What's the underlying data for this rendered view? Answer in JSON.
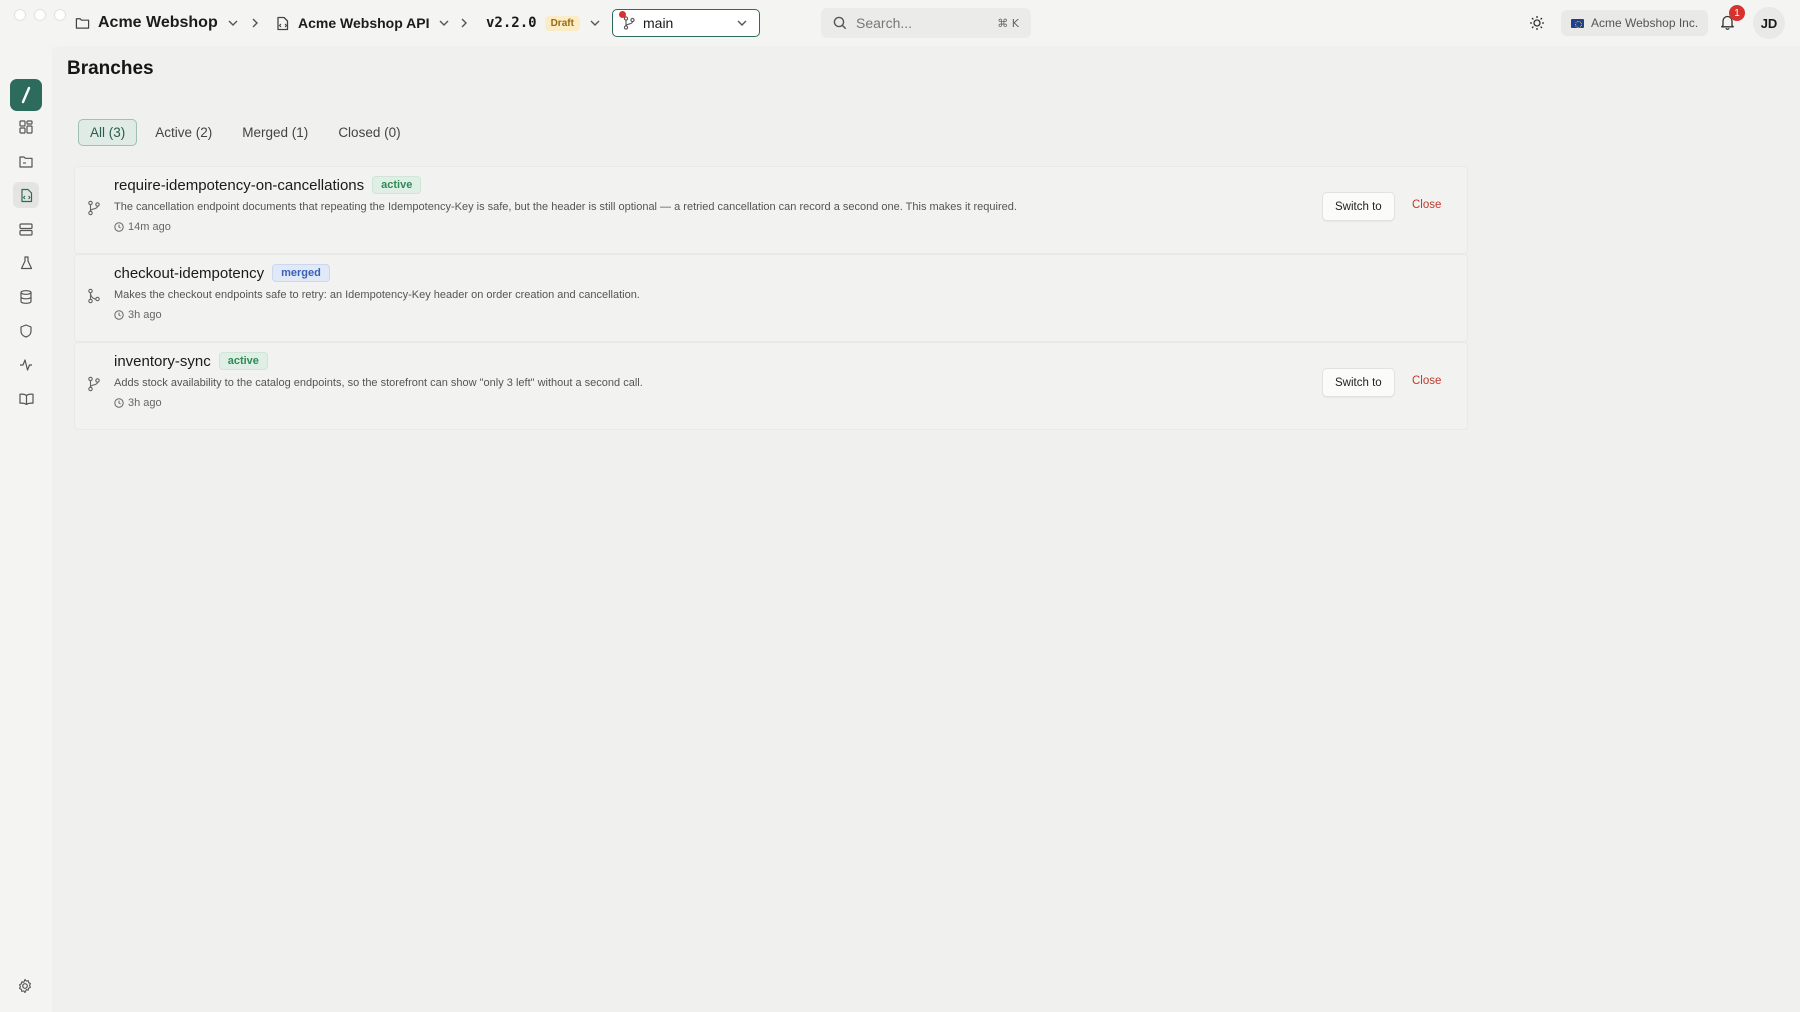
{
  "topbar": {
    "workspace": "Acme Webshop",
    "api": "Acme Webshop API",
    "version": "v2.2.0",
    "version_status": "Draft",
    "branch": "main",
    "search_placeholder": "Search...",
    "search_shortcut": "⌘ K",
    "org_name": "Acme Webshop Inc.",
    "notification_count": "1",
    "avatar_initials": "JD"
  },
  "page": {
    "title": "Branches"
  },
  "tabs": [
    {
      "label": "All (3)",
      "active": true
    },
    {
      "label": "Active (2)",
      "active": false
    },
    {
      "label": "Merged (1)",
      "active": false
    },
    {
      "label": "Closed (0)",
      "active": false
    }
  ],
  "branches": [
    {
      "name": "require-idempotency-on-cancellations",
      "status": "active",
      "description": "The cancellation endpoint documents that repeating the Idempotency-Key is safe, but the header is still optional — a retried cancellation can record a second one. This makes it required.",
      "time": "14m ago",
      "switch_label": "Switch to",
      "close_label": "Close"
    },
    {
      "name": "checkout-idempotency",
      "status": "merged",
      "description": "Makes the checkout endpoints safe to retry: an Idempotency-Key header on order creation and cancellation.",
      "time": "3h ago"
    },
    {
      "name": "inventory-sync",
      "status": "active",
      "description": "Adds stock availability to the catalog endpoints, so the storefront can show \"only 3 left\" without a second call.",
      "time": "3h ago",
      "switch_label": "Switch to",
      "close_label": "Close"
    }
  ],
  "sidebar": {
    "items": [
      {
        "icon": "dashboard-icon"
      },
      {
        "icon": "folder-icon"
      },
      {
        "icon": "branches-icon",
        "active": true
      },
      {
        "icon": "server-icon"
      },
      {
        "icon": "flask-icon"
      },
      {
        "icon": "database-icon"
      },
      {
        "icon": "shield-icon"
      },
      {
        "icon": "activity-icon"
      },
      {
        "icon": "book-icon"
      }
    ],
    "bottom_icon": "settings-icon"
  },
  "colors": {
    "accent": "#2d6b5c",
    "active_badge": "#2f8a55",
    "merged_badge": "#3a62b5",
    "danger": "#c0392b",
    "draft_badge": "#9a6a12"
  }
}
